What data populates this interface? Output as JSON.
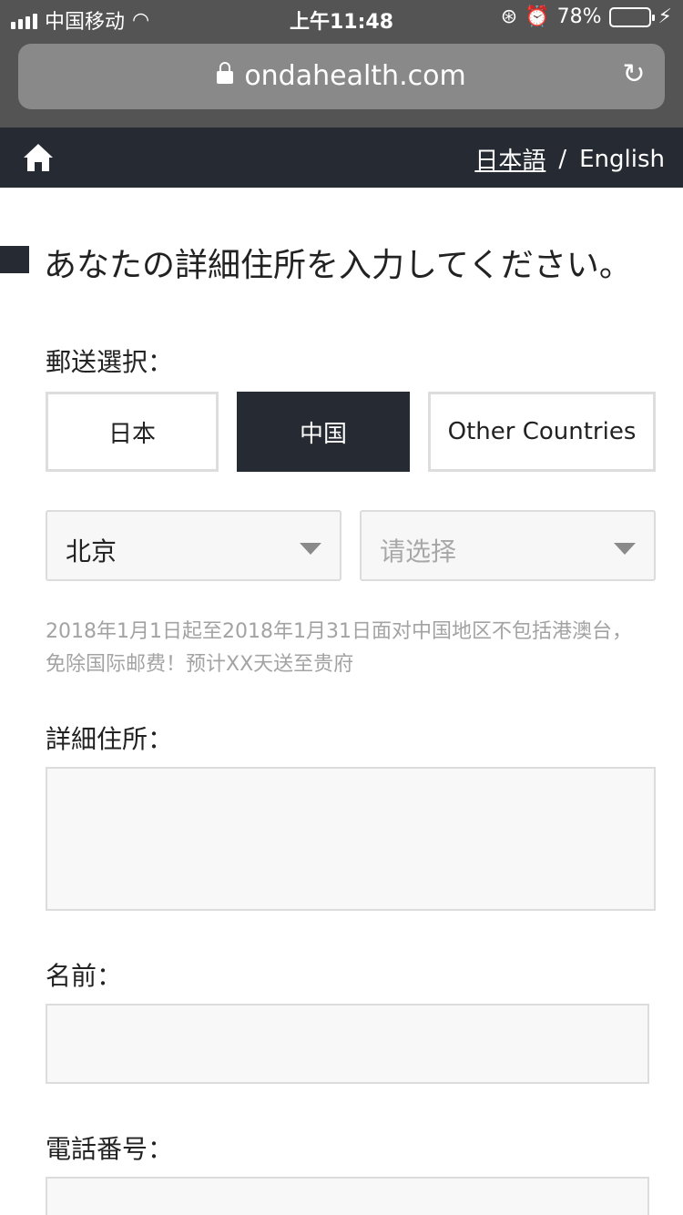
{
  "status": {
    "carrier": "中国移动",
    "time": "上午11:48",
    "battery": "78%",
    "battery_level": 0.78
  },
  "browser": {
    "url": "ondahealth.com"
  },
  "nav": {
    "lang_jp": "日本語",
    "separator": "/",
    "lang_en": "English"
  },
  "page": {
    "heading": "あなたの詳細住所を入力してください。",
    "shipping_label": "郵送選択：",
    "tabs": [
      {
        "label": "日本",
        "active": false
      },
      {
        "label": "中国",
        "active": true
      },
      {
        "label": "Other Countries",
        "active": false
      }
    ],
    "province_select": "北京",
    "city_select_placeholder": "请选择",
    "notice": "2018年1月1日起至2018年1月31日面对中国地区不包括港澳台，免除国际邮费！预计XX天送至贵府",
    "address_label": "詳細住所：",
    "name_label": "名前：",
    "phone_label": "電話番号："
  },
  "colors": {
    "dark": "#262a33",
    "chrome": "#545454",
    "battery_fill": "#4cd964",
    "notice_text": "#a3a3a3"
  }
}
